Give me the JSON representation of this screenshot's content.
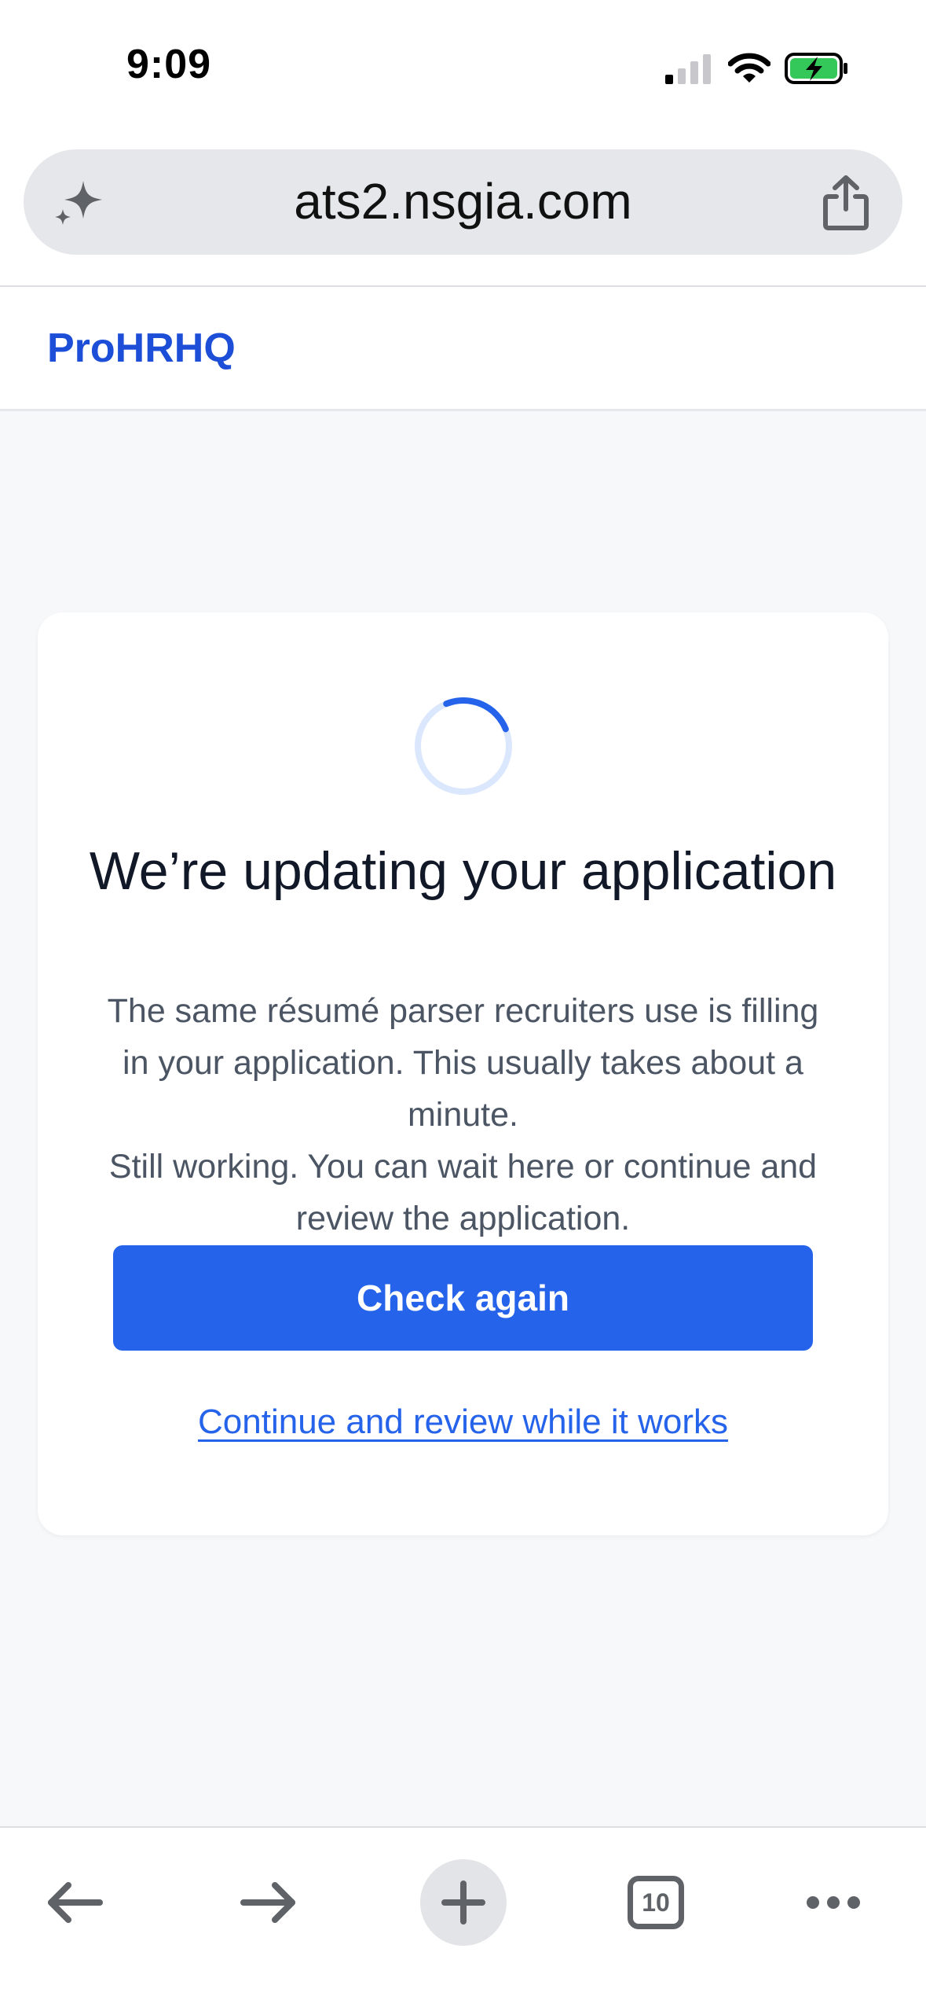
{
  "status_bar": {
    "time": "9:09",
    "icons": [
      "cellular-signal-icon",
      "wifi-icon",
      "battery-charging-icon"
    ]
  },
  "address_bar": {
    "url": "ats2.nsgia.com",
    "icons": [
      "sparkle-icon",
      "share-icon"
    ]
  },
  "site": {
    "brand": "ProHRHQ"
  },
  "card": {
    "title": "We’re updating your application",
    "body_text": "The same résumé parser recruiters use is filling in your application. This usually takes about a minute.",
    "status_text": "Still working. You can wait here or continue and review the application.",
    "primary_button": "Check again",
    "secondary_link": "Continue and review while it works",
    "spinner_progress": 0.25
  },
  "toolbar": {
    "tab_count": "10",
    "icons": [
      "back-arrow-icon",
      "forward-arrow-icon",
      "plus-icon",
      "tabs-icon",
      "more-icon"
    ]
  },
  "colors": {
    "accent": "#2563eb",
    "brand": "#1d4ed8",
    "page_background": "#f7f8fa",
    "battery_green": "#34c759"
  }
}
